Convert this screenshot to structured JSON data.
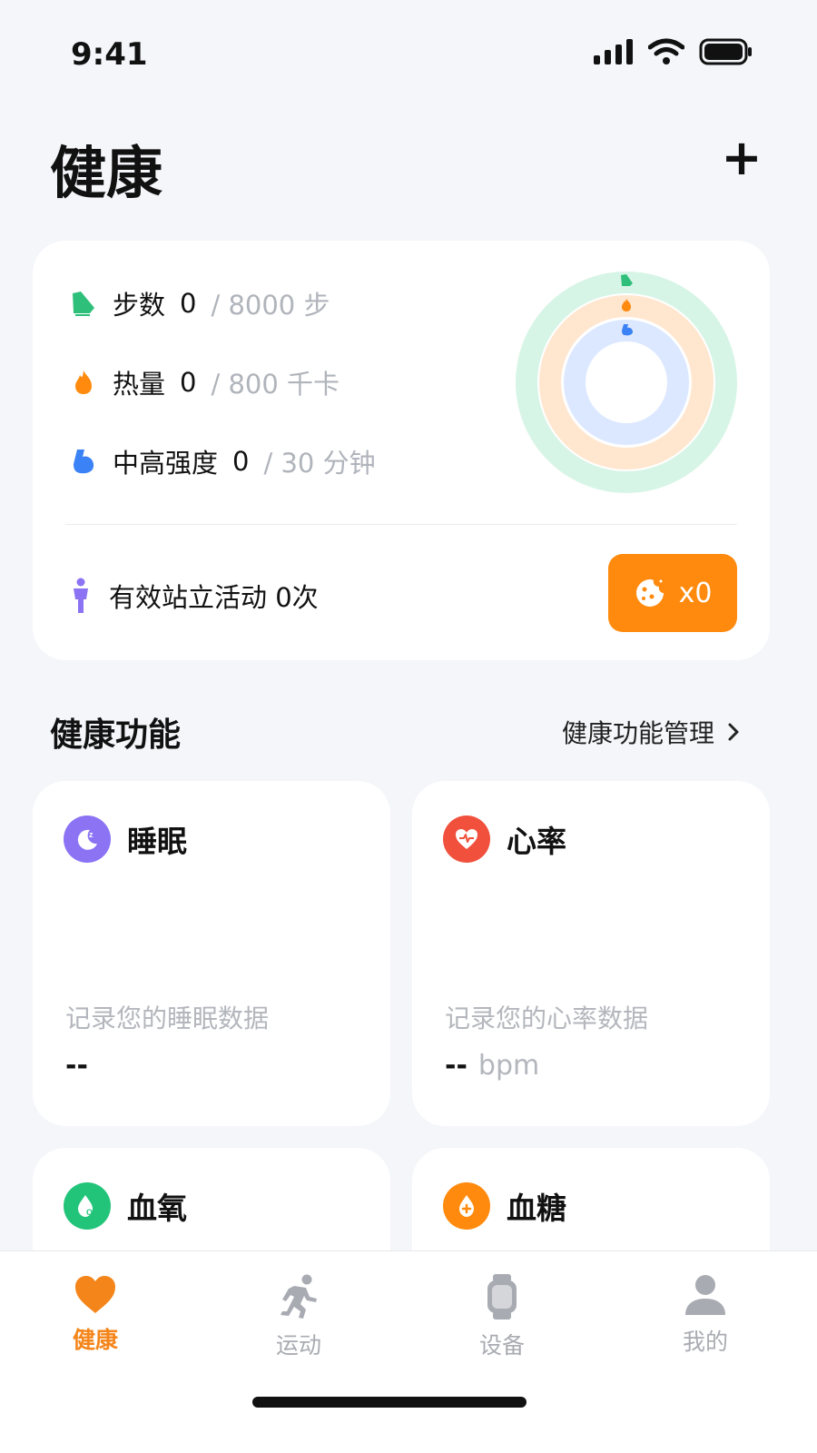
{
  "status_bar": {
    "time": "9:41"
  },
  "header": {
    "title": "健康",
    "add_label": "+"
  },
  "activity": {
    "metrics": [
      {
        "label": "步数",
        "value": "0",
        "goal": "/ 8000 步",
        "color": "#2ec07a"
      },
      {
        "label": "热量",
        "value": "0",
        "goal": "/ 800 千卡",
        "color": "#ff8a0d"
      },
      {
        "label": "中高强度",
        "value": "0",
        "goal": "/ 30 分钟",
        "color": "#3b82f6"
      }
    ],
    "rings": {
      "outer_color": "#d7f5e6",
      "middle_color": "#ffe6cf",
      "inner_color": "#dce8ff"
    },
    "stand_text": "有效站立活动 0次",
    "reward_label": "x0"
  },
  "section": {
    "title": "健康功能",
    "manage_label": "健康功能管理"
  },
  "cards": [
    {
      "title": "睡眠",
      "desc": "记录您的睡眠数据",
      "value": "--",
      "unit": "",
      "icon": "sleep-icon",
      "color": "#8b73f4"
    },
    {
      "title": "心率",
      "desc": "记录您的心率数据",
      "value": "--",
      "unit": "bpm",
      "icon": "heart-rate-icon",
      "color": "#f0503c"
    },
    {
      "title": "血氧",
      "icon": "blood-oxygen-icon",
      "color": "#22c47a"
    },
    {
      "title": "血糖",
      "icon": "blood-sugar-icon",
      "color": "#ff8a0d"
    }
  ],
  "tabs": [
    {
      "label": "健康",
      "active": true
    },
    {
      "label": "运动",
      "active": false
    },
    {
      "label": "设备",
      "active": false
    },
    {
      "label": "我的",
      "active": false
    }
  ]
}
